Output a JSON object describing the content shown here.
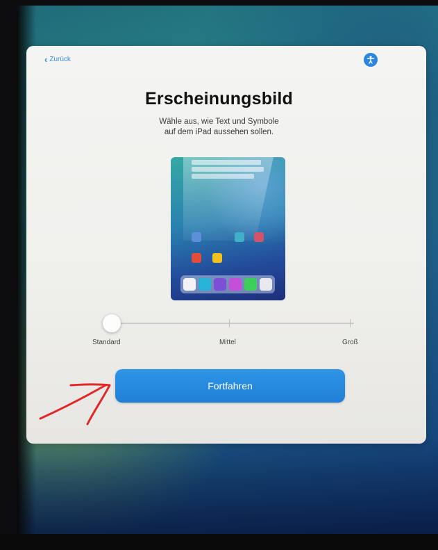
{
  "nav": {
    "back_label": "Zurück"
  },
  "setup": {
    "title": "Erscheinungsbild",
    "subtitle_line1": "Wähle aus, wie Text und Symbole",
    "subtitle_line2": "auf dem iPad aussehen sollen."
  },
  "size_slider": {
    "labels": [
      "Standard",
      "Mittel",
      "Groß"
    ],
    "selected": "Standard",
    "value_fraction": 0
  },
  "actions": {
    "continue_label": "Fortfahren"
  },
  "colors": {
    "accent": "#1f7fd6",
    "annotation": "#e0282a",
    "card_background": "#f2f2f0"
  },
  "icons": {
    "back": "chevron-left-icon",
    "accessibility": "accessibility-icon"
  }
}
